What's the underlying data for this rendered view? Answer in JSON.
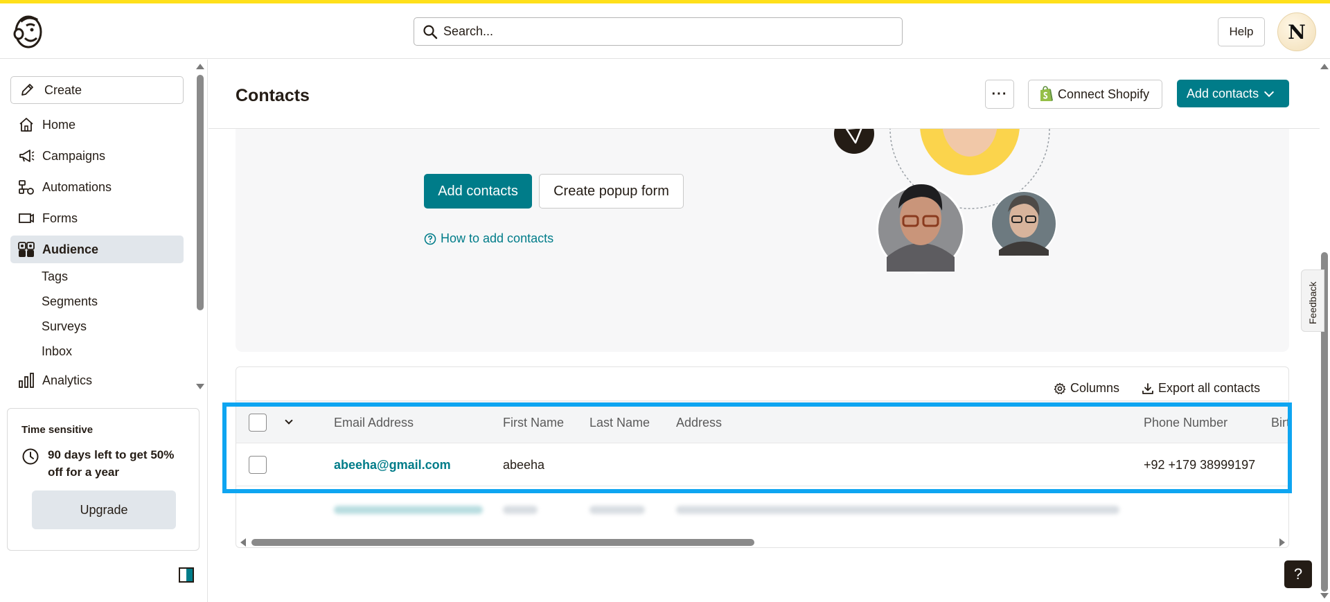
{
  "header": {
    "search_placeholder": "Search...",
    "help_label": "Help",
    "avatar_initial": "N"
  },
  "sidebar": {
    "create_label": "Create",
    "items": [
      {
        "label": "Home",
        "icon": "home-icon"
      },
      {
        "label": "Campaigns",
        "icon": "megaphone-icon"
      },
      {
        "label": "Automations",
        "icon": "automation-icon"
      },
      {
        "label": "Forms",
        "icon": "form-icon"
      },
      {
        "label": "Audience",
        "icon": "audience-icon",
        "active": true
      },
      {
        "label": "Analytics",
        "icon": "bar-chart-icon"
      }
    ],
    "audience_sub": [
      "Tags",
      "Segments",
      "Surveys",
      "Inbox"
    ],
    "promo": {
      "tag": "Time sensitive",
      "message": "90 days left to get 50% off for a year",
      "button": "Upgrade"
    }
  },
  "page": {
    "title": "Contacts",
    "more_label": "···",
    "shopify_label": "Connect Shopify",
    "add_contacts_label": "Add contacts"
  },
  "hero": {
    "add_contacts_label": "Add contacts",
    "popup_label": "Create popup form",
    "how_to_label": "How to add contacts"
  },
  "table": {
    "columns_label": "Columns",
    "export_label": "Export all contacts",
    "headers": [
      "Email Address",
      "First Name",
      "Last Name",
      "Address",
      "Phone Number",
      "Birt"
    ],
    "rows": [
      {
        "email": "abeeha@gmail.com",
        "first_name": "abeeha",
        "last_name": "",
        "address": "",
        "phone": "+92 +179 38999197"
      }
    ]
  },
  "feedback_label": "Feedback",
  "help_fab_label": "?",
  "colors": {
    "brand_yellow": "#ffe01b",
    "accent_teal": "#007c89",
    "highlight_blue": "#0ea5f1"
  }
}
